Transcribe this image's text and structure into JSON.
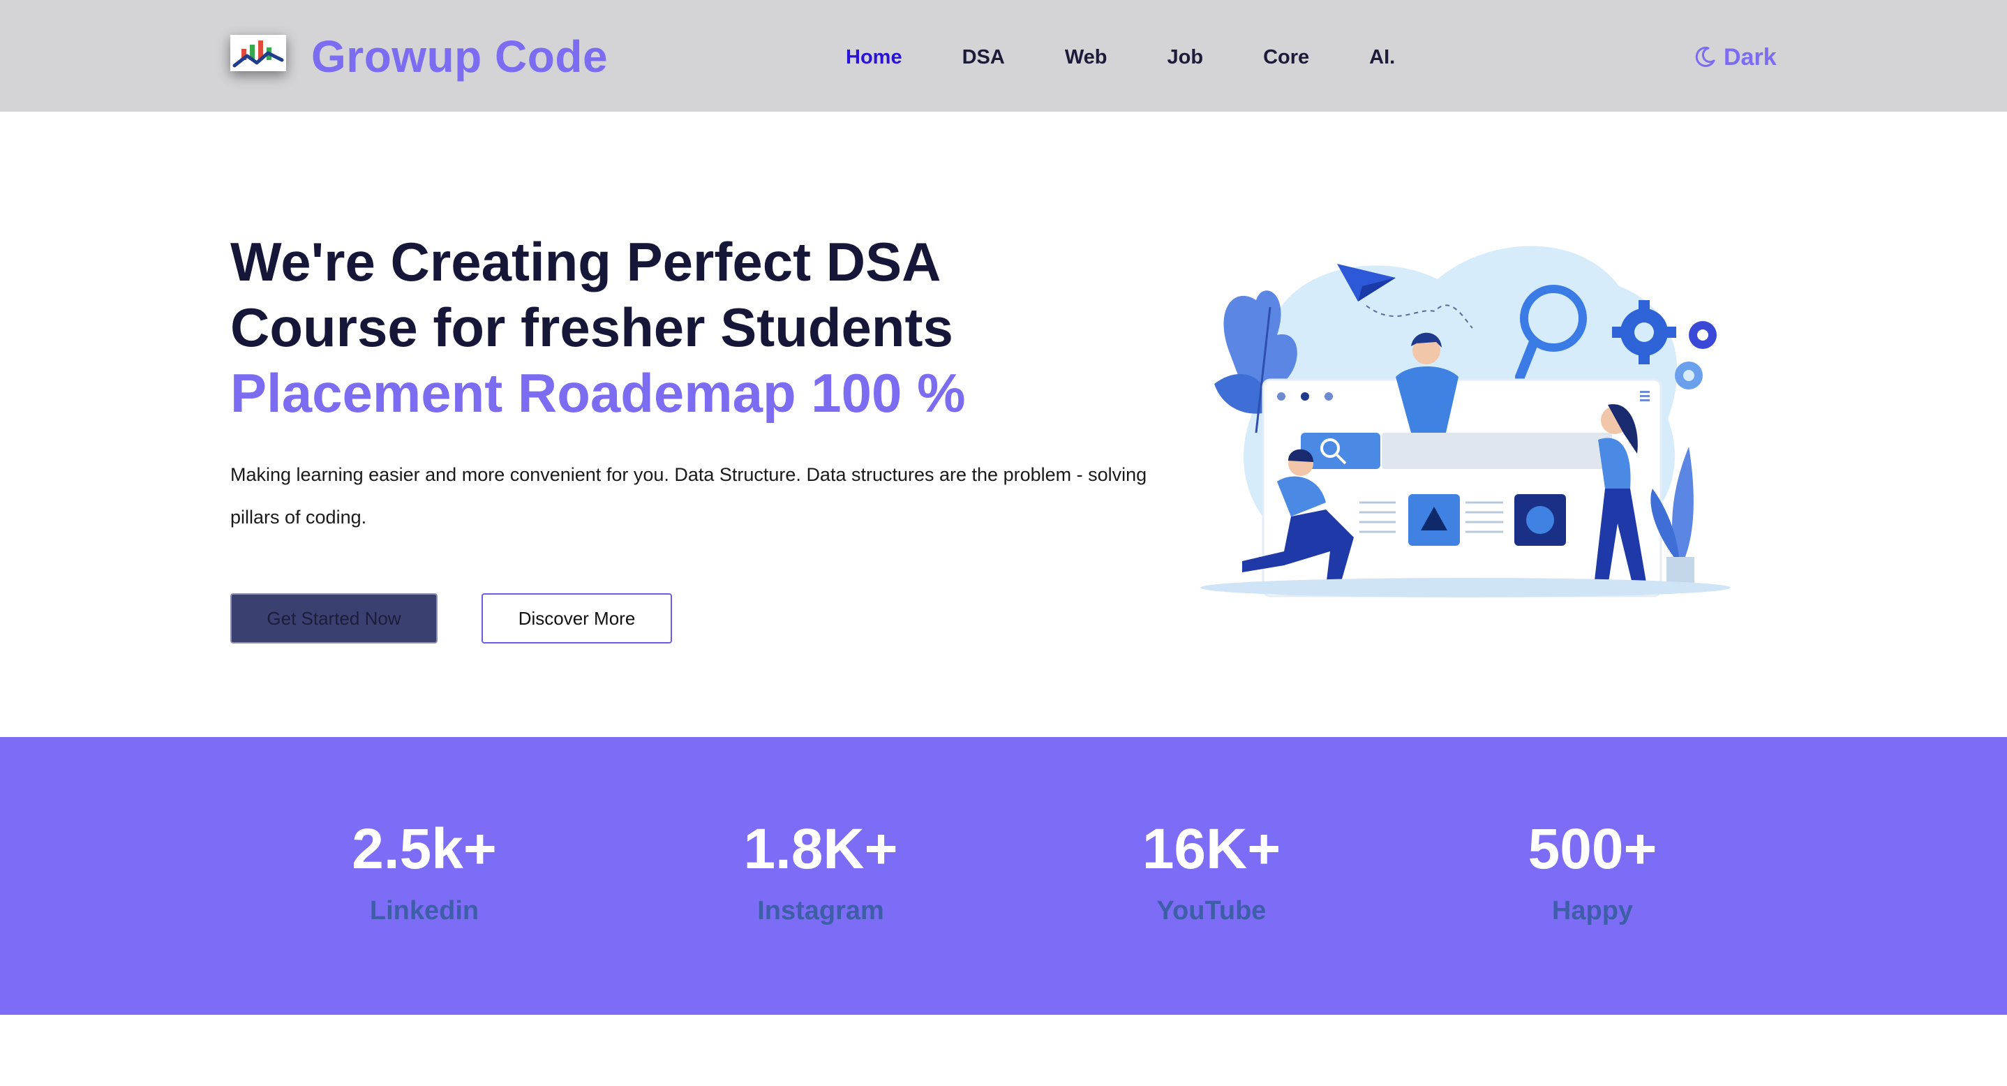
{
  "header": {
    "brand": "Growup Code",
    "nav": [
      "Home",
      "DSA",
      "Web",
      "Job",
      "Core",
      "AI."
    ],
    "active_nav": "Home",
    "theme_toggle_label": "Dark",
    "logo_icon": "chart-logo-icon",
    "theme_icon": "moon-icon"
  },
  "hero": {
    "title_line1": "We're Creating Perfect DSA",
    "title_line2": "Course for fresher Students",
    "title_accent": "Placement Roademap 100 %",
    "description": "Making learning easier and more convenient for you. Data Structure. Data structures are the problem - solving pillars of coding.",
    "primary_button": "Get Started Now",
    "secondary_button": "Discover More",
    "illustration": "team-building-website-illustration"
  },
  "stats": [
    {
      "value": "2.5k+",
      "label": "Linkedin"
    },
    {
      "value": "1.8K+",
      "label": "Instagram"
    },
    {
      "value": "16K+",
      "label": "YouTube"
    },
    {
      "value": "500+",
      "label": "Happy"
    }
  ],
  "colors": {
    "accent": "#7b6cf2",
    "nav_active": "#2a12d8",
    "navbar_bg": "#d4d4d7",
    "stats_bg": "#7d6cf6",
    "stat_label": "#3d5fa8",
    "primary_button_bg": "#3a4170"
  }
}
